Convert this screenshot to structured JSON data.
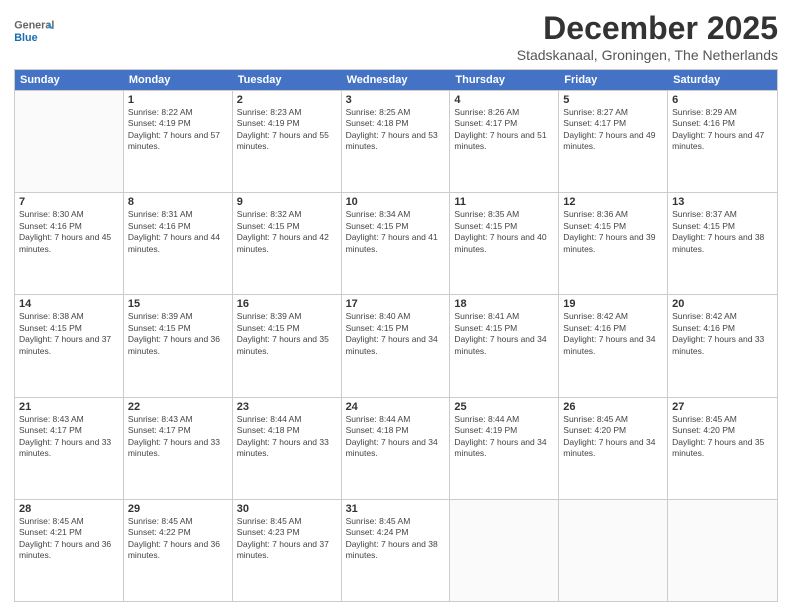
{
  "logo": {
    "general": "General",
    "blue": "Blue"
  },
  "title": "December 2025",
  "subtitle": "Stadskanaal, Groningen, The Netherlands",
  "days": [
    "Sunday",
    "Monday",
    "Tuesday",
    "Wednesday",
    "Thursday",
    "Friday",
    "Saturday"
  ],
  "weeks": [
    [
      {
        "day": "",
        "sunrise": "",
        "sunset": "",
        "daylight": ""
      },
      {
        "day": "1",
        "sunrise": "8:22 AM",
        "sunset": "4:19 PM",
        "daylight": "7 hours and 57 minutes."
      },
      {
        "day": "2",
        "sunrise": "8:23 AM",
        "sunset": "4:19 PM",
        "daylight": "7 hours and 55 minutes."
      },
      {
        "day": "3",
        "sunrise": "8:25 AM",
        "sunset": "4:18 PM",
        "daylight": "7 hours and 53 minutes."
      },
      {
        "day": "4",
        "sunrise": "8:26 AM",
        "sunset": "4:17 PM",
        "daylight": "7 hours and 51 minutes."
      },
      {
        "day": "5",
        "sunrise": "8:27 AM",
        "sunset": "4:17 PM",
        "daylight": "7 hours and 49 minutes."
      },
      {
        "day": "6",
        "sunrise": "8:29 AM",
        "sunset": "4:16 PM",
        "daylight": "7 hours and 47 minutes."
      }
    ],
    [
      {
        "day": "7",
        "sunrise": "8:30 AM",
        "sunset": "4:16 PM",
        "daylight": "7 hours and 45 minutes."
      },
      {
        "day": "8",
        "sunrise": "8:31 AM",
        "sunset": "4:16 PM",
        "daylight": "7 hours and 44 minutes."
      },
      {
        "day": "9",
        "sunrise": "8:32 AM",
        "sunset": "4:15 PM",
        "daylight": "7 hours and 42 minutes."
      },
      {
        "day": "10",
        "sunrise": "8:34 AM",
        "sunset": "4:15 PM",
        "daylight": "7 hours and 41 minutes."
      },
      {
        "day": "11",
        "sunrise": "8:35 AM",
        "sunset": "4:15 PM",
        "daylight": "7 hours and 40 minutes."
      },
      {
        "day": "12",
        "sunrise": "8:36 AM",
        "sunset": "4:15 PM",
        "daylight": "7 hours and 39 minutes."
      },
      {
        "day": "13",
        "sunrise": "8:37 AM",
        "sunset": "4:15 PM",
        "daylight": "7 hours and 38 minutes."
      }
    ],
    [
      {
        "day": "14",
        "sunrise": "8:38 AM",
        "sunset": "4:15 PM",
        "daylight": "7 hours and 37 minutes."
      },
      {
        "day": "15",
        "sunrise": "8:39 AM",
        "sunset": "4:15 PM",
        "daylight": "7 hours and 36 minutes."
      },
      {
        "day": "16",
        "sunrise": "8:39 AM",
        "sunset": "4:15 PM",
        "daylight": "7 hours and 35 minutes."
      },
      {
        "day": "17",
        "sunrise": "8:40 AM",
        "sunset": "4:15 PM",
        "daylight": "7 hours and 34 minutes."
      },
      {
        "day": "18",
        "sunrise": "8:41 AM",
        "sunset": "4:15 PM",
        "daylight": "7 hours and 34 minutes."
      },
      {
        "day": "19",
        "sunrise": "8:42 AM",
        "sunset": "4:16 PM",
        "daylight": "7 hours and 34 minutes."
      },
      {
        "day": "20",
        "sunrise": "8:42 AM",
        "sunset": "4:16 PM",
        "daylight": "7 hours and 33 minutes."
      }
    ],
    [
      {
        "day": "21",
        "sunrise": "8:43 AM",
        "sunset": "4:17 PM",
        "daylight": "7 hours and 33 minutes."
      },
      {
        "day": "22",
        "sunrise": "8:43 AM",
        "sunset": "4:17 PM",
        "daylight": "7 hours and 33 minutes."
      },
      {
        "day": "23",
        "sunrise": "8:44 AM",
        "sunset": "4:18 PM",
        "daylight": "7 hours and 33 minutes."
      },
      {
        "day": "24",
        "sunrise": "8:44 AM",
        "sunset": "4:18 PM",
        "daylight": "7 hours and 34 minutes."
      },
      {
        "day": "25",
        "sunrise": "8:44 AM",
        "sunset": "4:19 PM",
        "daylight": "7 hours and 34 minutes."
      },
      {
        "day": "26",
        "sunrise": "8:45 AM",
        "sunset": "4:20 PM",
        "daylight": "7 hours and 34 minutes."
      },
      {
        "day": "27",
        "sunrise": "8:45 AM",
        "sunset": "4:20 PM",
        "daylight": "7 hours and 35 minutes."
      }
    ],
    [
      {
        "day": "28",
        "sunrise": "8:45 AM",
        "sunset": "4:21 PM",
        "daylight": "7 hours and 36 minutes."
      },
      {
        "day": "29",
        "sunrise": "8:45 AM",
        "sunset": "4:22 PM",
        "daylight": "7 hours and 36 minutes."
      },
      {
        "day": "30",
        "sunrise": "8:45 AM",
        "sunset": "4:23 PM",
        "daylight": "7 hours and 37 minutes."
      },
      {
        "day": "31",
        "sunrise": "8:45 AM",
        "sunset": "4:24 PM",
        "daylight": "7 hours and 38 minutes."
      },
      {
        "day": "",
        "sunrise": "",
        "sunset": "",
        "daylight": ""
      },
      {
        "day": "",
        "sunrise": "",
        "sunset": "",
        "daylight": ""
      },
      {
        "day": "",
        "sunrise": "",
        "sunset": "",
        "daylight": ""
      }
    ]
  ]
}
